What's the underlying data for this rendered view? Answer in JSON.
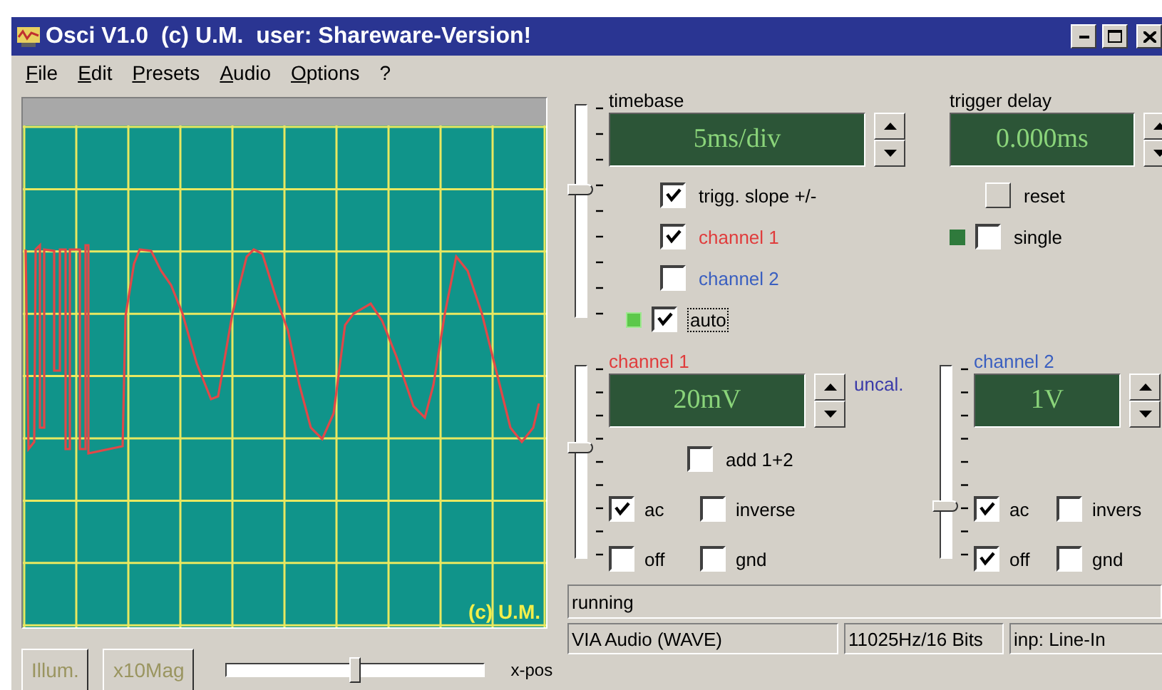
{
  "window": {
    "title": "Osci V1.0  (c) U.M.  user: Shareware-Version!"
  },
  "menu": [
    "File",
    "Edit",
    "Presets",
    "Audio",
    "Options",
    "?"
  ],
  "scope": {
    "mark": "(c) U.M."
  },
  "timebase": {
    "label": "timebase",
    "value": "5ms/div",
    "slider": {
      "level": 0.6
    },
    "options": [
      {
        "kind": "checkbox",
        "label": "trigg. slope +/-",
        "checked": true,
        "focused": false
      },
      {
        "kind": "checkbox",
        "label": "channel 1",
        "checked": true,
        "focused": false,
        "color": "#e03c3c"
      },
      {
        "kind": "checkbox",
        "label": "channel 2",
        "checked": false,
        "focused": false,
        "color": "#3a5fc0"
      },
      {
        "kind": "led-checkbox",
        "label": "auto",
        "checked": true,
        "focused": true,
        "led_on": true
      }
    ]
  },
  "trigger": {
    "label": "trigger delay",
    "value": "0.000ms",
    "reset": "reset",
    "single": {
      "label": "single",
      "checked": false,
      "led_on": false
    }
  },
  "channels": [
    {
      "label": "channel 1",
      "color": "#e03c3c",
      "value": "20mV",
      "note": "uncal.",
      "slider": {
        "level": 0.57
      },
      "add": {
        "label": "add 1+2",
        "checked": false
      },
      "options": [
        {
          "label": "ac",
          "checked": true
        },
        {
          "label": "inverse",
          "checked": false
        },
        {
          "label": "off",
          "checked": false
        },
        {
          "label": "gnd",
          "checked": false
        }
      ]
    },
    {
      "label": "channel 2",
      "color": "#3a5fc0",
      "value": "1V",
      "slider": {
        "level": 0.27
      },
      "options": [
        {
          "label": "ac",
          "checked": true
        },
        {
          "label": "invers",
          "checked": false
        },
        {
          "label": "off",
          "checked": true
        },
        {
          "label": "gnd",
          "checked": false
        }
      ]
    }
  ],
  "controls": {
    "buttons": [
      "Illum.",
      "x10Mag"
    ],
    "xpos": {
      "label": "x-pos",
      "level": 0.5
    }
  },
  "status": {
    "message": "running",
    "device": "VIA Audio (WAVE)",
    "format": "11025Hz/16 Bits",
    "input": "inp: Line-In"
  }
}
